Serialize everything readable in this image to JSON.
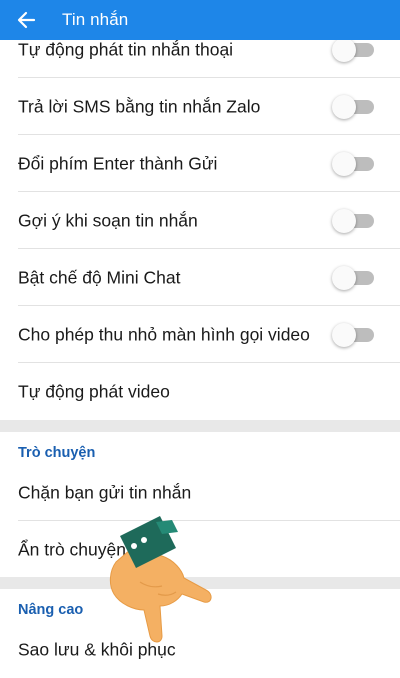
{
  "header": {
    "title": "Tin nhắn"
  },
  "settings_rows": [
    {
      "label": "Tự động phát tin nhắn thoại",
      "toggle": false
    },
    {
      "label": "Trả lời SMS bằng tin nhắn Zalo",
      "toggle": false
    },
    {
      "label": "Đổi phím Enter thành Gửi",
      "toggle": false
    },
    {
      "label": "Gợi ý khi soạn tin nhắn",
      "toggle": false
    },
    {
      "label": "Bật chế độ Mini Chat",
      "toggle": false
    },
    {
      "label": "Cho phép thu nhỏ màn hình gọi video",
      "toggle": false
    },
    {
      "label": "Tự động phát video"
    }
  ],
  "sections": {
    "chat": {
      "title": "Trò chuyện",
      "items": [
        "Chặn bạn gửi tin nhắn",
        "Ẩn trò chuyện"
      ]
    },
    "advanced": {
      "title": "Nâng cao",
      "items": [
        "Sao lưu & khôi phục"
      ]
    }
  },
  "colors": {
    "header": "#1e86e8",
    "section_title": "#1a5fb0",
    "toggle_off_track": "#bdbdbd"
  }
}
